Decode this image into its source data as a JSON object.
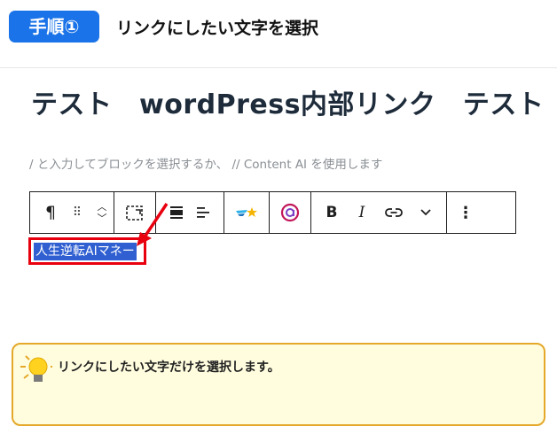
{
  "step": {
    "badge": "手順①",
    "title": "リンクにしたい文字を選択"
  },
  "editor": {
    "post_title": "テスト　wordPress内部リンク　テスト",
    "block_placeholder": "/ と入力してブロックを選択するか、 // Content AI を使用します",
    "selected_text": "人生逆転AIマネー"
  },
  "toolbar": {
    "paragraph_symbol": "¶",
    "drag_symbol": "⠿",
    "bold_label": "B",
    "italic_label": "I",
    "more_symbol": "⋮"
  },
  "tip": {
    "text": "リンクにしたい文字だけを選択します。"
  },
  "colors": {
    "accent": "#1a73e8",
    "highlight": "#e8000f",
    "selection": "#2f5fd1",
    "tip_border": "#e5a82a",
    "tip_bg": "#fffdde"
  }
}
